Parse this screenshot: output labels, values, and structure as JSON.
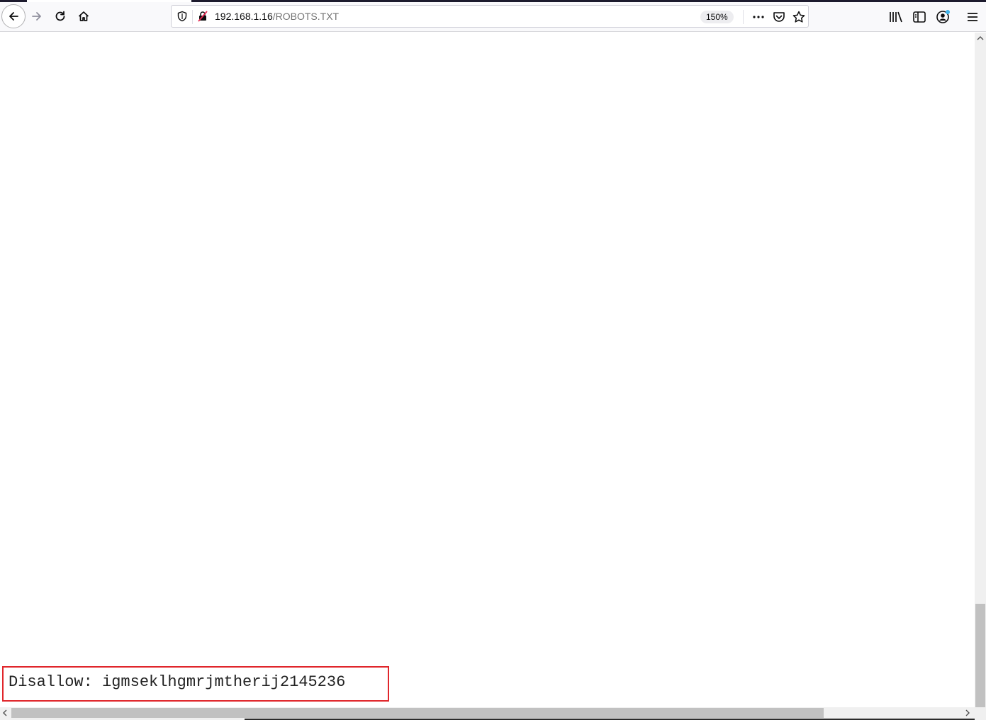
{
  "browser": {
    "url_host": "192.168.1.16",
    "url_path": "/ROBOTS.TXT",
    "zoom_level": "150%",
    "icons": {
      "back": "back-arrow-icon",
      "forward": "forward-arrow-icon",
      "reload": "reload-icon",
      "home": "home-icon",
      "tracking": "shield-icon",
      "insecure": "insecure-lock-icon",
      "page_actions": "more-dots-icon",
      "pocket": "pocket-icon",
      "bookmark": "star-icon",
      "library": "library-icon",
      "sidebar": "sidebar-icon",
      "account": "account-icon",
      "menu": "hamburger-menu-icon"
    }
  },
  "page": {
    "robots_line": "Disallow: igmseklhgmrjmtherij2145236",
    "highlight_color": "#e0262b"
  }
}
